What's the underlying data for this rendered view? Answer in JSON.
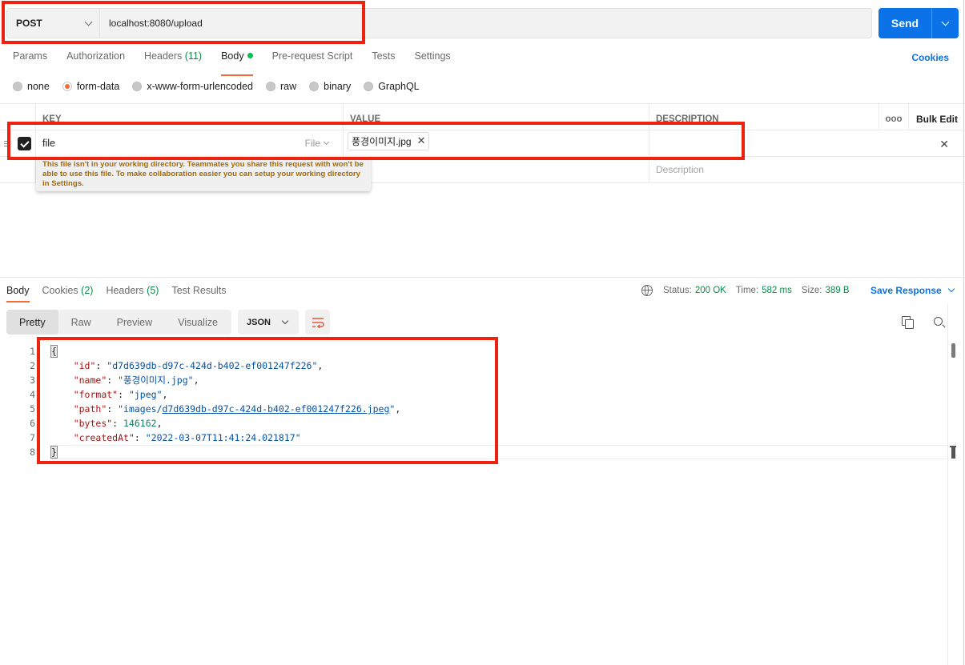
{
  "request": {
    "method": "POST",
    "url": "localhost:8080/upload",
    "send_label": "Send"
  },
  "req_tabs": {
    "params": "Params",
    "authorization": "Authorization",
    "headers": "Headers",
    "headers_count": "(11)",
    "body": "Body",
    "prerequest": "Pre-request Script",
    "tests": "Tests",
    "settings": "Settings",
    "cookies": "Cookies"
  },
  "body_types": {
    "none": "none",
    "form_data": "form-data",
    "urlencoded": "x-www-form-urlencoded",
    "raw": "raw",
    "binary": "binary",
    "graphql": "GraphQL",
    "selected": "form-data"
  },
  "table": {
    "headers": {
      "key": "KEY",
      "value": "VALUE",
      "description": "DESCRIPTION",
      "bulk_edit": "Bulk Edit",
      "more": "ooo"
    },
    "row": {
      "key": "file",
      "type": "File",
      "file_name": "풍경이미지.jpg"
    },
    "empty_row": {
      "description_placeholder": "Description",
      "value_placeholder_fragment": "e"
    },
    "tooltip": "This file isn't in your working directory. Teammates you share this request with won't be able to use this file. To make collaboration easier you can setup your working directory in Settings."
  },
  "response": {
    "tabs": {
      "body": "Body",
      "cookies": "Cookies",
      "cookies_count": "(2)",
      "headers": "Headers",
      "headers_count": "(5)",
      "test_results": "Test Results"
    },
    "status_label": "Status:",
    "status_value": "200 OK",
    "time_label": "Time:",
    "time_value": "582 ms",
    "size_label": "Size:",
    "size_value": "389 B",
    "save_label": "Save Response",
    "views": [
      "Pretty",
      "Raw",
      "Preview",
      "Visualize"
    ],
    "format": "JSON",
    "line_numbers": [
      "1",
      "2",
      "3",
      "4",
      "5",
      "6",
      "7",
      "8"
    ],
    "json": {
      "id_key": "\"id\"",
      "id_val": "\"d7d639db-d97c-424d-b402-ef001247f226\"",
      "name_key": "\"name\"",
      "name_val": "\"풍경이미지.jpg\"",
      "format_key": "\"format\"",
      "format_val": "\"jpeg\"",
      "path_key": "\"path\"",
      "path_val_pre": "\"images/",
      "path_val_link": "d7d639db-d97c-424d-b402-ef001247f226.jpeg",
      "path_val_post": "\"",
      "bytes_key": "\"bytes\"",
      "bytes_val": "146162",
      "created_key": "\"createdAt\"",
      "created_val": "\"2022-03-07T11:41:24.021817\""
    }
  },
  "colors": {
    "accent": "#0b72e7",
    "highlight_box": "#ee2211",
    "active_tab": "#f26b3a",
    "success": "#0d8a4a",
    "warning_text": "#a86a00"
  }
}
